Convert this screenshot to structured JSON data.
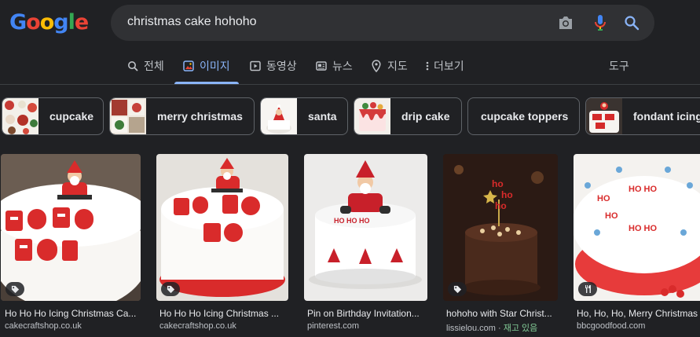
{
  "search": {
    "query": "christmas cake hohoho"
  },
  "tabs": [
    {
      "label": "전체",
      "icon": "search-icon"
    },
    {
      "label": "이미지",
      "icon": "image-icon",
      "active": true
    },
    {
      "label": "동영상",
      "icon": "video-icon"
    },
    {
      "label": "뉴스",
      "icon": "news-icon"
    },
    {
      "label": "지도",
      "icon": "map-pin-icon"
    },
    {
      "label": "더보기",
      "icon": "more-vert-icon"
    }
  ],
  "tools_label": "도구",
  "chips": [
    {
      "label": "cupcake"
    },
    {
      "label": "merry christmas"
    },
    {
      "label": "santa"
    },
    {
      "label": "drip cake"
    },
    {
      "label": "cupcake toppers"
    },
    {
      "label": "fondant icing"
    }
  ],
  "results": [
    {
      "title": "Ho Ho Ho Icing Christmas Ca...",
      "source": "cakecraftshop.co.uk",
      "badge": "tag-icon"
    },
    {
      "title": "Ho Ho Ho Icing Christmas ...",
      "source": "cakecraftshop.co.uk",
      "badge": "tag-icon"
    },
    {
      "title": "Pin on Birthday Invitation...",
      "source": "pinterest.com"
    },
    {
      "title": "hohoho with Star Christ...",
      "source": "lissielou.com",
      "source_extra": "재고 있음",
      "badge": "tag-icon"
    },
    {
      "title": "Ho, Ho, Ho, Merry Christmas",
      "source": "bbcgoodfood.com",
      "badge": "restaurant-icon"
    }
  ],
  "colors": {
    "background": "#202124",
    "searchbar": "#303134",
    "accent": "#8ab4f8",
    "stock": "#81c995",
    "cake_red": "#d92b2b"
  }
}
